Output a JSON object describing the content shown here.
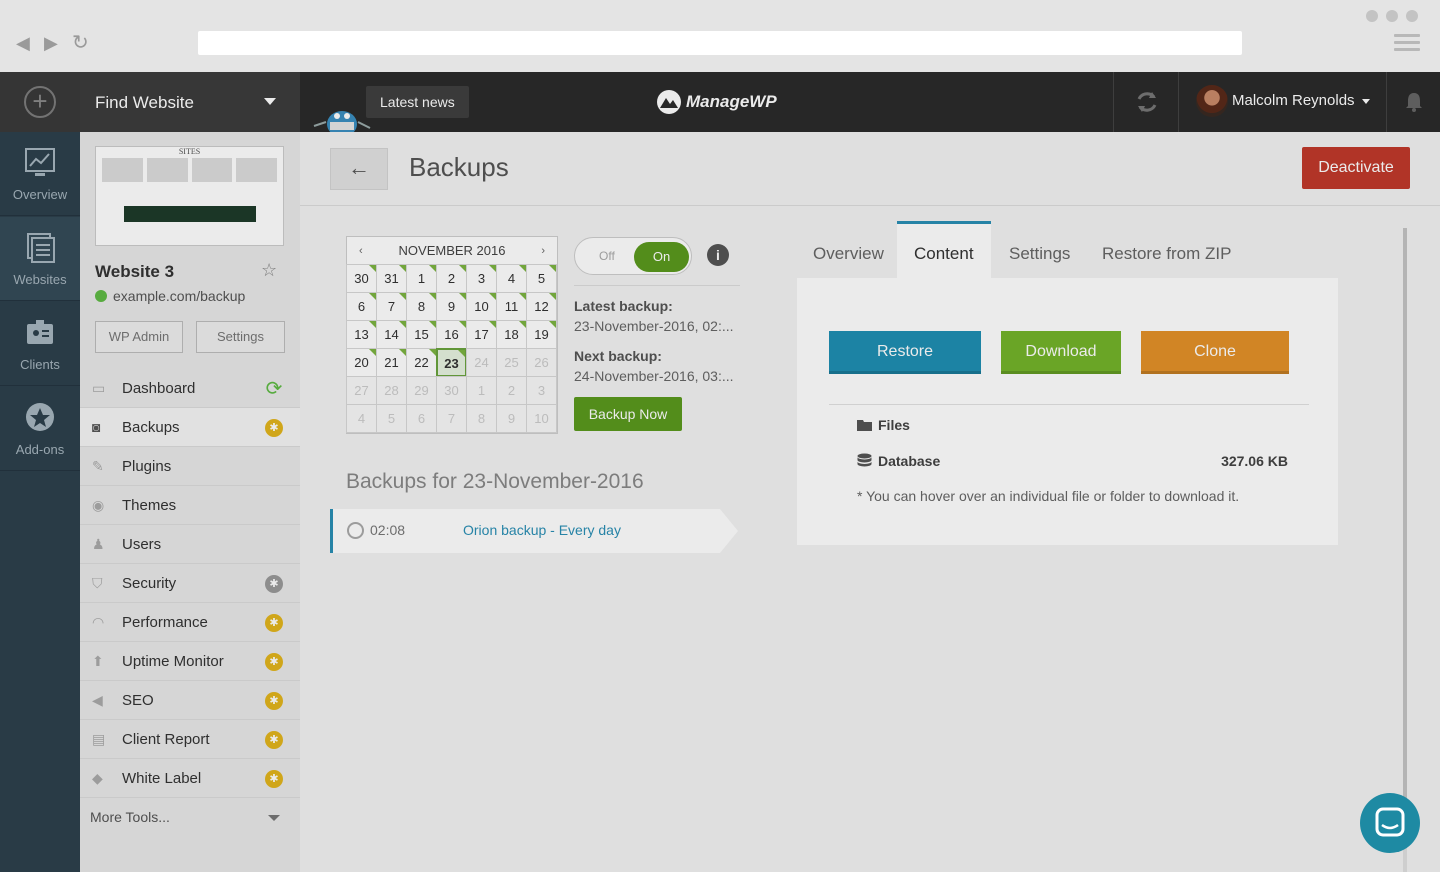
{
  "header": {
    "find_website": "Find Website",
    "latest_news": "Latest news",
    "logo": "ManageWP",
    "user_name": "Malcolm Reynolds"
  },
  "rail": [
    {
      "label": "Overview",
      "icon": "chart-icon"
    },
    {
      "label": "Websites",
      "icon": "websites-icon"
    },
    {
      "label": "Clients",
      "icon": "clients-icon"
    },
    {
      "label": "Add-ons",
      "icon": "addons-icon"
    }
  ],
  "site": {
    "title": "Website 3",
    "url": "example.com/backup",
    "wp_admin": "WP Admin",
    "settings": "Settings",
    "thumb_text": "SITES"
  },
  "menu": [
    {
      "label": "Dashboard",
      "icon": "dashboard-icon",
      "badge": "sync"
    },
    {
      "label": "Backups",
      "icon": "backups-icon",
      "badge": "gold"
    },
    {
      "label": "Plugins",
      "icon": "plugins-icon",
      "badge": ""
    },
    {
      "label": "Themes",
      "icon": "themes-icon",
      "badge": ""
    },
    {
      "label": "Users",
      "icon": "users-icon",
      "badge": ""
    },
    {
      "label": "Security",
      "icon": "shield-icon",
      "badge": "grey"
    },
    {
      "label": "Performance",
      "icon": "gauge-icon",
      "badge": "gold"
    },
    {
      "label": "Uptime Monitor",
      "icon": "uptime-icon",
      "badge": "gold"
    },
    {
      "label": "SEO",
      "icon": "megaphone-icon",
      "badge": "gold"
    },
    {
      "label": "Client Report",
      "icon": "report-icon",
      "badge": "gold"
    },
    {
      "label": "White Label",
      "icon": "tag-icon",
      "badge": "gold"
    }
  ],
  "menu_more": "More Tools...",
  "page": {
    "title": "Backups",
    "deactivate": "Deactivate"
  },
  "calendar": {
    "month": "NOVEMBER 2016",
    "prev": "‹",
    "next": "›",
    "weeks": [
      [
        "30",
        "31",
        "1",
        "2",
        "3",
        "4",
        "5"
      ],
      [
        "6",
        "7",
        "8",
        "9",
        "10",
        "11",
        "12"
      ],
      [
        "13",
        "14",
        "15",
        "16",
        "17",
        "18",
        "19"
      ],
      [
        "20",
        "21",
        "22",
        "23",
        "24",
        "25",
        "26"
      ],
      [
        "27",
        "28",
        "29",
        "30",
        "1",
        "2",
        "3"
      ],
      [
        "4",
        "5",
        "6",
        "7",
        "8",
        "9",
        "10"
      ]
    ],
    "selected": "23"
  },
  "toggle": {
    "off": "Off",
    "on": "On"
  },
  "latest_backup": {
    "label": "Latest backup:",
    "value": "23-November-2016, 02:..."
  },
  "next_backup": {
    "label": "Next backup:",
    "value": "24-November-2016, 03:..."
  },
  "backup_now": "Backup Now",
  "backups_for": "Backups for 23-November-2016",
  "backup_entry": {
    "time": "02:08",
    "name": "Orion backup - Every day"
  },
  "tabs": [
    "Overview",
    "Content",
    "Settings",
    "Restore from ZIP"
  ],
  "content": {
    "restore": "Restore",
    "download": "Download",
    "clone": "Clone",
    "files": "Files",
    "database": "Database",
    "db_size": "327.06 KB",
    "hint": "* You can hover over an individual file or folder to download it."
  },
  "colors": {
    "restore": "#1f8fb2",
    "download": "#74b42a",
    "clone": "#e39129",
    "deactivate": "#c0392b",
    "accent_green": "#5b9a1e",
    "rail": "#2d414d"
  }
}
